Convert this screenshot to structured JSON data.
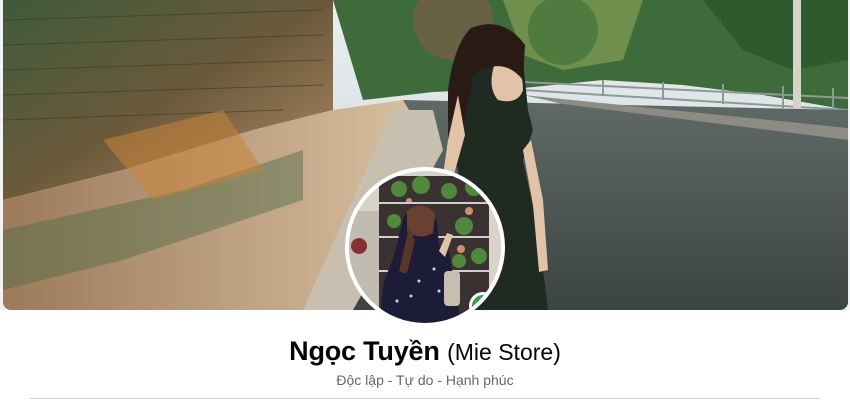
{
  "profile": {
    "display_name": "Ngọc Tuyền",
    "alternate_name": "(Mie Store)",
    "bio": "Độc lập - Tự do - Hạnh phúc",
    "online": true
  },
  "colors": {
    "online": "#31a24c",
    "name": "#050505",
    "secondary_text": "#65676b",
    "divider": "#ced0d4"
  }
}
